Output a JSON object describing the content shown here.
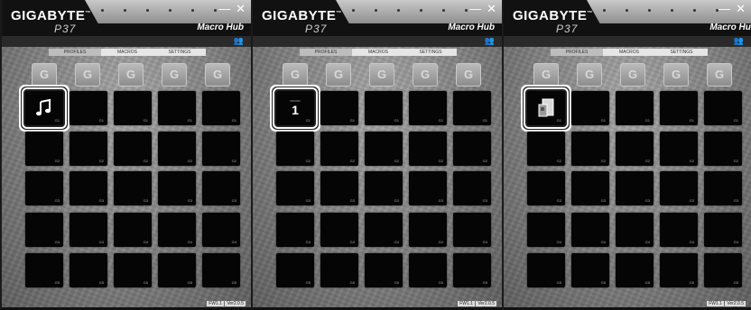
{
  "panels": [
    {
      "brand": "GIGABYTE",
      "model": "P37",
      "app_title": "Macro Hub",
      "tabs": [
        "PROFILES",
        "MACROS",
        "SETTINGS"
      ],
      "g_label": "G",
      "row_labels": [
        "G1",
        "G2",
        "G3",
        "G4",
        "G5"
      ],
      "footer": {
        "fw": "FW1.1",
        "ver": "Ver2.0.5"
      },
      "selected_icon": "music-note-icon",
      "selected_text": ""
    },
    {
      "brand": "GIGABYTE",
      "model": "P37",
      "app_title": "Macro Hub",
      "tabs": [
        "PROFILES",
        "MACROS",
        "SETTINGS"
      ],
      "g_label": "G",
      "row_labels": [
        "G1",
        "G2",
        "G3",
        "G4",
        "G5"
      ],
      "footer": {
        "fw": "FW1.1",
        "ver": "Ver2.0.5"
      },
      "selected_icon": "macro-key-icon",
      "selected_text": "1"
    },
    {
      "brand": "GIGABYTE",
      "model": "P37",
      "app_title": "Macro Hub",
      "tabs": [
        "PROFILES",
        "MACROS",
        "SETTINGS"
      ],
      "g_label": "G",
      "row_labels": [
        "G1",
        "G2",
        "G3",
        "G4",
        "G5"
      ],
      "footer": {
        "fw": "FW1.1",
        "ver": "Ver2.0.5"
      },
      "selected_icon": "app-launcher-icon",
      "selected_text": ""
    }
  ],
  "icons": {
    "minimize": "minimize-icon",
    "close": "close-icon",
    "user": "user-profile-icon"
  }
}
